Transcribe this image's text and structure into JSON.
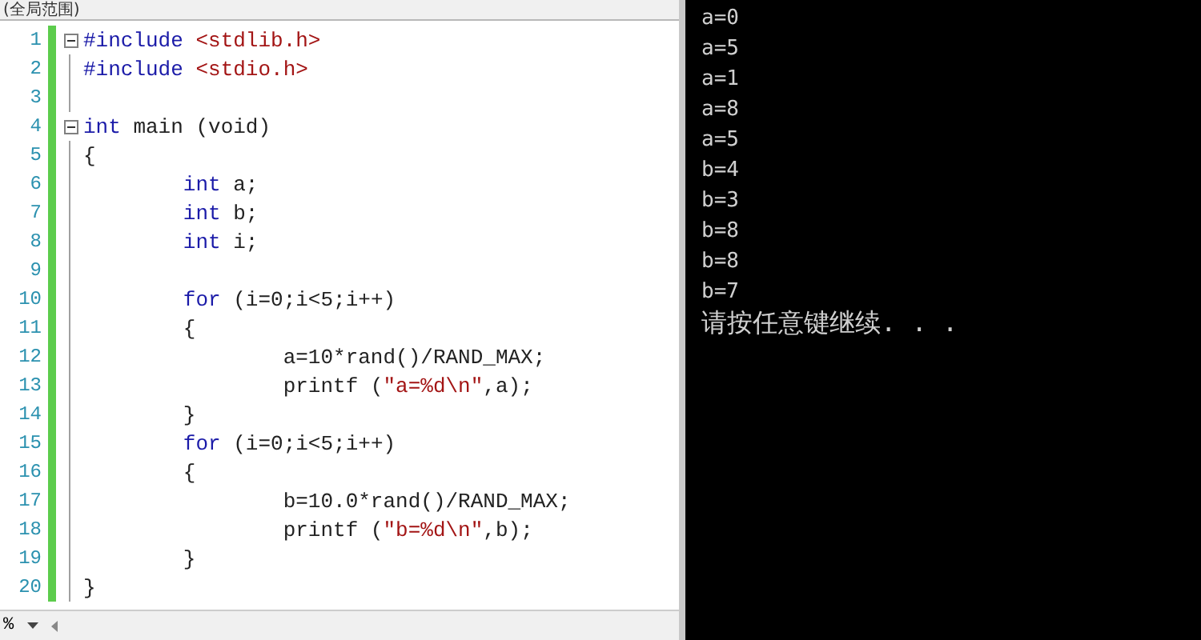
{
  "editor": {
    "scope_label": "(全局范围)",
    "lines": [
      {
        "number": "1",
        "fold_box": true,
        "tokens": [
          {
            "kind": "preproc",
            "text": "#include"
          },
          {
            "kind": "header",
            "text": " <stdlib.h>"
          }
        ]
      },
      {
        "number": "2",
        "fold_box": false,
        "tokens": [
          {
            "kind": "preproc",
            "text": "#include"
          },
          {
            "kind": "header",
            "text": " <stdio.h>"
          }
        ]
      },
      {
        "number": "3",
        "fold_box": false
      },
      {
        "number": "4",
        "fold_box": true,
        "tokens": [
          {
            "kind": "keyword",
            "text": "int"
          },
          {
            "kind": "plain",
            "text": " main (void)"
          }
        ]
      },
      {
        "number": "5",
        "fold_box": false,
        "tokens": [
          {
            "kind": "plain",
            "text": "{"
          }
        ]
      },
      {
        "number": "6",
        "fold_box": false,
        "tokens": [
          {
            "kind": "keyword",
            "text": "\tint"
          },
          {
            "kind": "plain",
            "text": " a;"
          }
        ]
      },
      {
        "number": "7",
        "fold_box": false,
        "tokens": [
          {
            "kind": "keyword",
            "text": "\tint"
          },
          {
            "kind": "plain",
            "text": " b;"
          }
        ]
      },
      {
        "number": "8",
        "fold_box": false,
        "tokens": [
          {
            "kind": "keyword",
            "text": "\tint"
          },
          {
            "kind": "plain",
            "text": " i;"
          }
        ]
      },
      {
        "number": "9",
        "fold_box": false
      },
      {
        "number": "10",
        "fold_box": false,
        "tokens": [
          {
            "kind": "keyword",
            "text": "\tfor"
          },
          {
            "kind": "plain",
            "text": " (i=0;i<5;i++)"
          }
        ]
      },
      {
        "number": "11",
        "fold_box": false,
        "tokens": [
          {
            "kind": "plain",
            "text": "\t{"
          }
        ]
      },
      {
        "number": "12",
        "fold_box": false,
        "tokens": [
          {
            "kind": "plain",
            "text": "\t\ta=10*rand()/RAND_MAX;"
          }
        ]
      },
      {
        "number": "13",
        "fold_box": false,
        "tokens": [
          {
            "kind": "plain",
            "text": "\t\tprintf ("
          },
          {
            "kind": "string",
            "text": "\"a=%d\\n\""
          },
          {
            "kind": "plain",
            "text": ",a);"
          }
        ]
      },
      {
        "number": "14",
        "fold_box": false,
        "tokens": [
          {
            "kind": "plain",
            "text": "\t}"
          }
        ]
      },
      {
        "number": "15",
        "fold_box": false,
        "tokens": [
          {
            "kind": "keyword",
            "text": "\tfor"
          },
          {
            "kind": "plain",
            "text": " (i=0;i<5;i++)"
          }
        ]
      },
      {
        "number": "16",
        "fold_box": false,
        "tokens": [
          {
            "kind": "plain",
            "text": "\t{"
          }
        ]
      },
      {
        "number": "17",
        "fold_box": false,
        "tokens": [
          {
            "kind": "plain",
            "text": "\t\tb=10.0*rand()/RAND_MAX;"
          }
        ]
      },
      {
        "number": "18",
        "fold_box": false,
        "tokens": [
          {
            "kind": "plain",
            "text": "\t\tprintf ("
          },
          {
            "kind": "string",
            "text": "\"b=%d\\n\""
          },
          {
            "kind": "plain",
            "text": ",b);"
          }
        ]
      },
      {
        "number": "19",
        "fold_box": false,
        "tokens": [
          {
            "kind": "plain",
            "text": "\t}"
          }
        ]
      },
      {
        "number": "20",
        "fold_box": false,
        "tokens": [
          {
            "kind": "plain",
            "text": "}"
          }
        ]
      }
    ],
    "zoom": "%"
  },
  "console": {
    "lines": [
      "a=0",
      "a=5",
      "a=1",
      "a=8",
      "a=5",
      "b=4",
      "b=3",
      "b=8",
      "b=8",
      "b=7",
      "请按任意键继续. . ."
    ]
  }
}
